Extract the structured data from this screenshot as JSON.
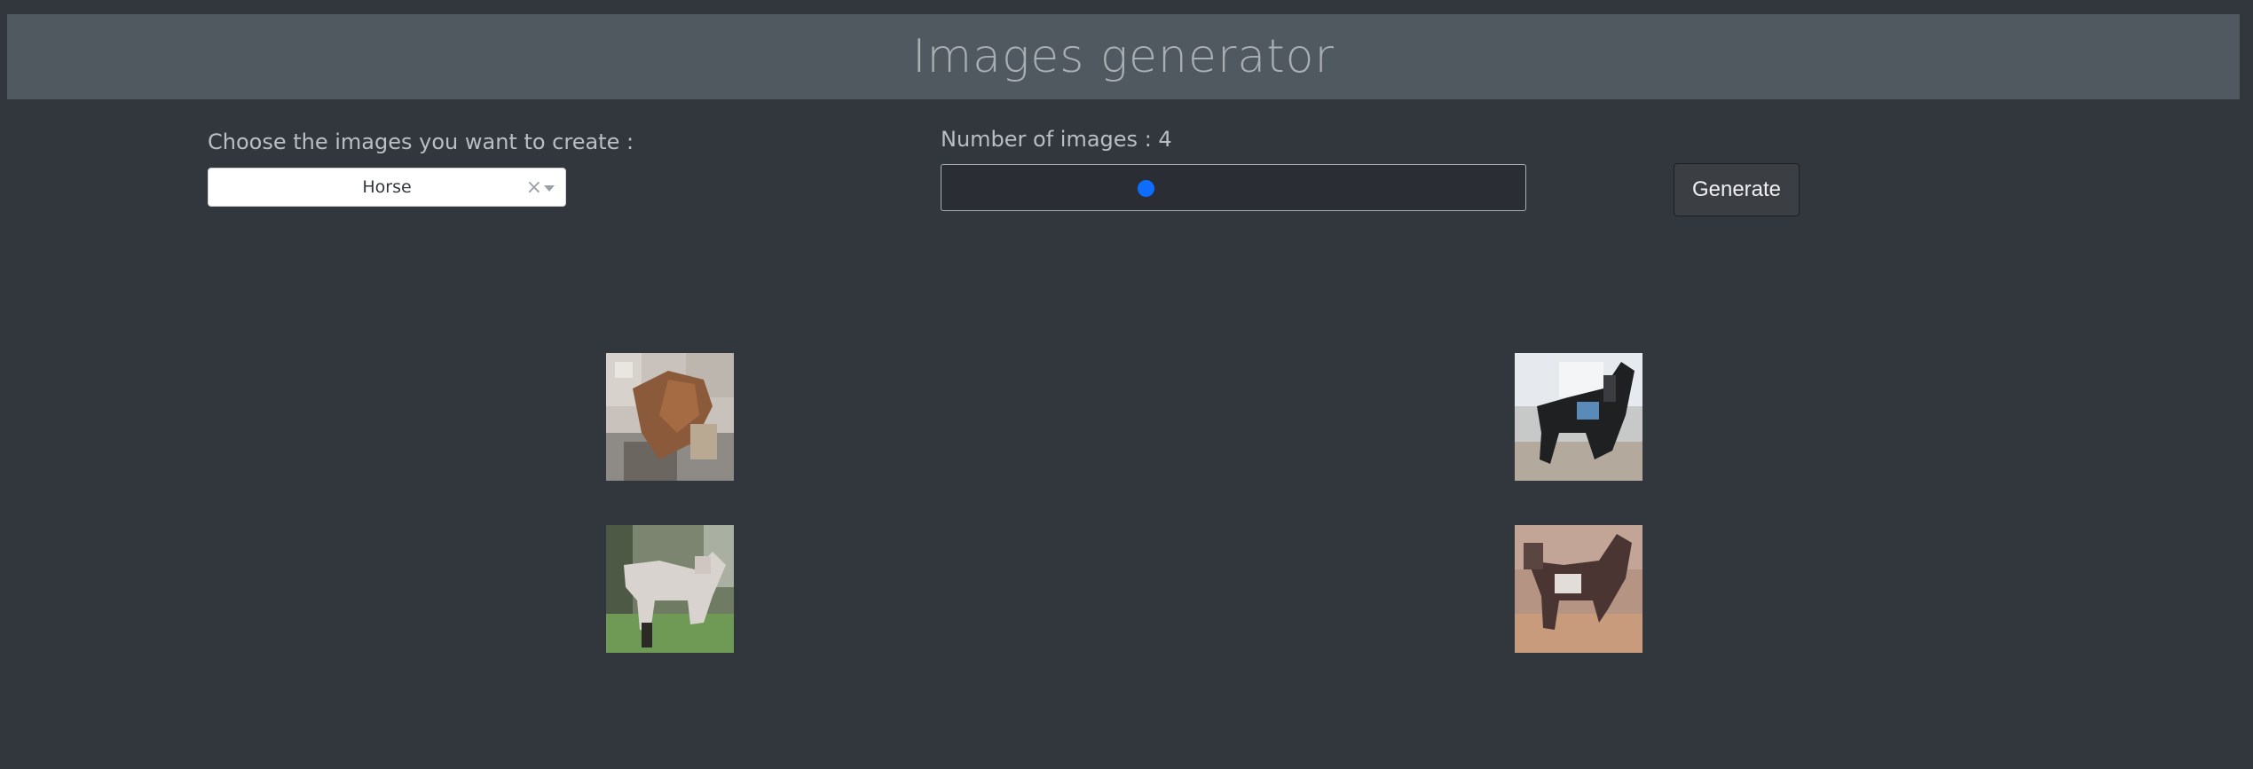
{
  "header": {
    "title": "Images generator"
  },
  "controls": {
    "select_label": "Choose the images you want to create :",
    "selected_class": "Horse",
    "clear_icon": "×",
    "range_label_prefix": "Number of images : ",
    "image_count": 4,
    "image_count_min": 1,
    "image_count_max": 10,
    "generate_label": "Generate"
  },
  "colors": {
    "background": "#32373e",
    "header": "#515960",
    "slider_thumb": "#0d6efd"
  },
  "images": [
    {
      "name": "generated-horse-1",
      "subject": "horse"
    },
    {
      "name": "generated-horse-2",
      "subject": "horse"
    },
    {
      "name": "generated-horse-3",
      "subject": "horse"
    },
    {
      "name": "generated-horse-4",
      "subject": "horse"
    }
  ]
}
